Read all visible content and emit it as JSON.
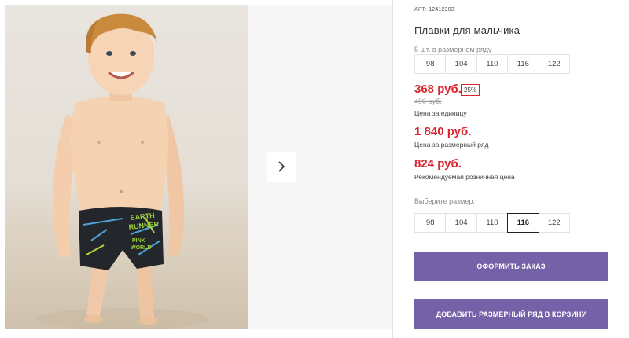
{
  "product": {
    "art_label": "АРТ:",
    "art_number": "12412303",
    "title": "Плавки для мальчика",
    "pack_hint": "5 шт. в размерном ряду",
    "pack_sizes": [
      "98",
      "104",
      "110",
      "116",
      "122"
    ],
    "price_unit": "368 руб.",
    "discount": "25%",
    "old_price": "490 руб.",
    "price_unit_caption": "Цена за единицу",
    "price_row": "1 840 руб.",
    "price_row_caption": "Цена за размерный ряд",
    "price_retail": "824 руб.",
    "price_retail_caption": "Рекомендуемая розничная цена",
    "choose_size_hint": "Выберите размер:",
    "choose_sizes": [
      "98",
      "104",
      "110",
      "116",
      "122"
    ],
    "selected_size": "116",
    "order_button": "ОФОРМИТЬ ЗАКАЗ",
    "add_row_button": "ДОБАВИТЬ РАЗМЕРНЫЙ РЯД В КОРЗИНУ"
  },
  "gallery": {
    "photo_alt": "Мальчик в плавках",
    "swim_print_text_1": "EARTH",
    "swim_print_text_2": "RUNNER",
    "swim_print_text_3": "PINK",
    "swim_print_text_4": "WORLD",
    "next_icon": "chevron-right-icon"
  },
  "colors": {
    "accent": "#7561a8",
    "price": "#d9262e"
  }
}
